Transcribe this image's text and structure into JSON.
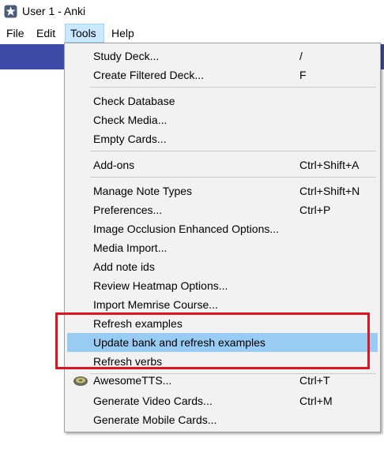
{
  "window": {
    "title": "User 1 - Anki",
    "app_icon": "anki-star-icon"
  },
  "menubar": {
    "items": [
      "File",
      "Edit",
      "Tools",
      "Help"
    ],
    "active": "Tools"
  },
  "tools_menu": {
    "study_deck": {
      "label": "Study Deck...",
      "shortcut": "/"
    },
    "create_filtered": {
      "label": "Create Filtered Deck...",
      "shortcut": "F"
    },
    "check_database": {
      "label": "Check Database"
    },
    "check_media": {
      "label": "Check Media..."
    },
    "empty_cards": {
      "label": "Empty Cards..."
    },
    "addons": {
      "label": "Add-ons",
      "shortcut": "Ctrl+Shift+A"
    },
    "manage_note_types": {
      "label": "Manage Note Types",
      "shortcut": "Ctrl+Shift+N"
    },
    "preferences": {
      "label": "Preferences...",
      "shortcut": "Ctrl+P"
    },
    "image_occlusion": {
      "label": "Image Occlusion Enhanced Options..."
    },
    "media_import": {
      "label": "Media Import..."
    },
    "add_note_ids": {
      "label": "Add note ids"
    },
    "review_heatmap": {
      "label": "Review Heatmap Options..."
    },
    "import_memrise": {
      "label": "Import Memrise Course..."
    },
    "refresh_examples": {
      "label": "Refresh examples"
    },
    "update_bank": {
      "label": "Update bank and refresh examples",
      "highlighted": true
    },
    "refresh_verbs": {
      "label": "Refresh verbs"
    },
    "awesometts": {
      "label": "AwesomeTTS...",
      "shortcut": "Ctrl+T",
      "icon": "speaker-icon"
    },
    "generate_video": {
      "label": "Generate Video Cards...",
      "shortcut": "Ctrl+M"
    },
    "generate_mobile": {
      "label": "Generate Mobile Cards..."
    }
  },
  "colors": {
    "menu_bg": "#f2f2f2",
    "hover": "#99ccf3",
    "annotation_box": "#e0141e",
    "band": "#3d4ba7"
  }
}
